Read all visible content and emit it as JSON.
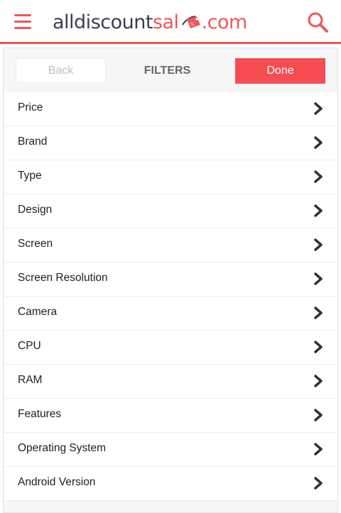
{
  "header": {
    "logo_dark": "alldiscount",
    "logo_red_a": "sal",
    "logo_red_b": ".com",
    "menu_icon": "hamburger-menu-icon",
    "search_icon": "search-icon",
    "accent_color": "#f0565b"
  },
  "toolbar": {
    "back_label": "Back",
    "title": "FILTERS",
    "done_label": "Done"
  },
  "filters": [
    {
      "label": "Price"
    },
    {
      "label": "Brand"
    },
    {
      "label": "Type"
    },
    {
      "label": "Design"
    },
    {
      "label": "Screen"
    },
    {
      "label": "Screen Resolution"
    },
    {
      "label": "Camera"
    },
    {
      "label": "CPU"
    },
    {
      "label": "RAM"
    },
    {
      "label": "Features"
    },
    {
      "label": "Operating System"
    },
    {
      "label": "Android Version"
    }
  ],
  "colors": {
    "accent": "#f0565b",
    "done_button": "#f64d52",
    "logo_dark": "#3c3c55",
    "panel_bg": "#f6f6f6"
  }
}
